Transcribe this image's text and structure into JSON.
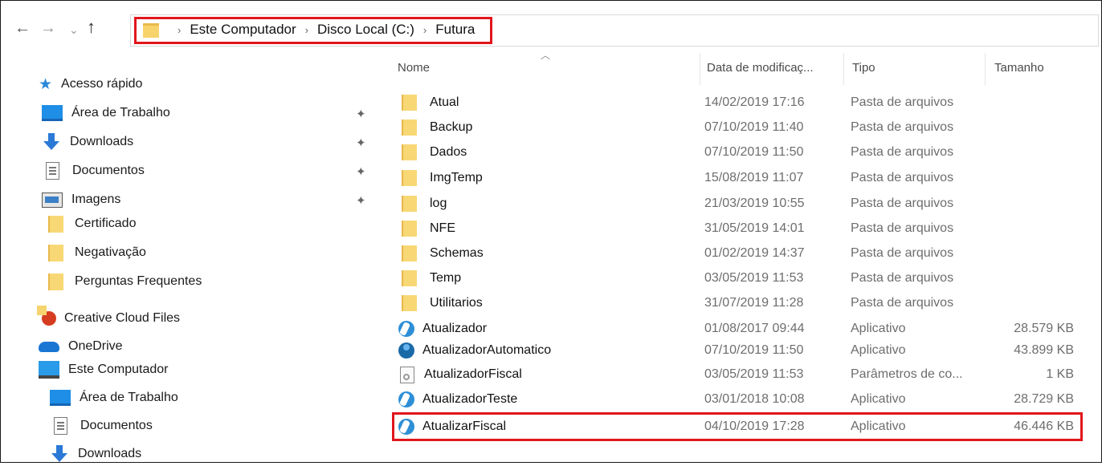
{
  "breadcrumb": [
    "Este Computador",
    "Disco Local (C:)",
    "Futura"
  ],
  "nav_icons": {
    "back": "back-arrow-icon",
    "forward": "forward-arrow-icon",
    "recent": "chevron-down-icon",
    "up": "up-arrow-icon"
  },
  "sidebar": {
    "quick_access": "Acesso rápido",
    "items": [
      {
        "label": "Área de Trabalho",
        "icon": "desktop-icon",
        "pinned": true
      },
      {
        "label": "Downloads",
        "icon": "download-icon",
        "pinned": true
      },
      {
        "label": "Documentos",
        "icon": "document-icon",
        "pinned": true
      },
      {
        "label": "Imagens",
        "icon": "image-icon",
        "pinned": true
      },
      {
        "label": "Certificado",
        "icon": "folder-icon",
        "pinned": false
      },
      {
        "label": "Negativação",
        "icon": "folder-icon",
        "pinned": false
      },
      {
        "label": "Perguntas Frequentes",
        "icon": "folder-icon",
        "pinned": false
      }
    ],
    "creative_cloud": "Creative Cloud Files",
    "onedrive": "OneDrive",
    "this_pc": "Este Computador",
    "pc_items": [
      {
        "label": "Área de Trabalho",
        "icon": "desktop-icon"
      },
      {
        "label": "Documentos",
        "icon": "document-icon"
      },
      {
        "label": "Downloads",
        "icon": "download-icon"
      }
    ]
  },
  "columns": {
    "name": "Nome",
    "date": "Data de modificaç...",
    "type": "Tipo",
    "size": "Tamanho"
  },
  "files": [
    {
      "name": "Atual",
      "date": "14/02/2019 17:16",
      "type": "Pasta de arquivos",
      "size": "",
      "icon": "folder-icon"
    },
    {
      "name": "Backup",
      "date": "07/10/2019 11:40",
      "type": "Pasta de arquivos",
      "size": "",
      "icon": "folder-icon"
    },
    {
      "name": "Dados",
      "date": "07/10/2019 11:50",
      "type": "Pasta de arquivos",
      "size": "",
      "icon": "folder-icon"
    },
    {
      "name": "ImgTemp",
      "date": "15/08/2019 11:07",
      "type": "Pasta de arquivos",
      "size": "",
      "icon": "folder-icon"
    },
    {
      "name": "log",
      "date": "21/03/2019 10:55",
      "type": "Pasta de arquivos",
      "size": "",
      "icon": "folder-icon"
    },
    {
      "name": "NFE",
      "date": "31/05/2019 14:01",
      "type": "Pasta de arquivos",
      "size": "",
      "icon": "folder-icon"
    },
    {
      "name": "Schemas",
      "date": "01/02/2019 14:37",
      "type": "Pasta de arquivos",
      "size": "",
      "icon": "folder-icon"
    },
    {
      "name": "Temp",
      "date": "03/05/2019 11:53",
      "type": "Pasta de arquivos",
      "size": "",
      "icon": "folder-icon"
    },
    {
      "name": "Utilitarios",
      "date": "31/07/2019 11:28",
      "type": "Pasta de arquivos",
      "size": "",
      "icon": "folder-icon"
    },
    {
      "name": "Atualizador",
      "date": "01/08/2017 09:44",
      "type": "Aplicativo",
      "size": "28.579 KB",
      "icon": "app-icon"
    },
    {
      "name": "AtualizadorAutomatico",
      "date": "07/10/2019 11:50",
      "type": "Aplicativo",
      "size": "43.899 KB",
      "icon": "app-globe-icon"
    },
    {
      "name": "AtualizadorFiscal",
      "date": "03/05/2019 11:53",
      "type": "Parâmetros de co...",
      "size": "1 KB",
      "icon": "config-file-icon"
    },
    {
      "name": "AtualizadorTeste",
      "date": "03/01/2018 10:08",
      "type": "Aplicativo",
      "size": "28.729 KB",
      "icon": "app-icon"
    },
    {
      "name": "AtualizarFiscal",
      "date": "04/10/2019 17:28",
      "type": "Aplicativo",
      "size": "46.446 KB",
      "icon": "app-icon"
    }
  ],
  "highlight_color": "#e1161c"
}
